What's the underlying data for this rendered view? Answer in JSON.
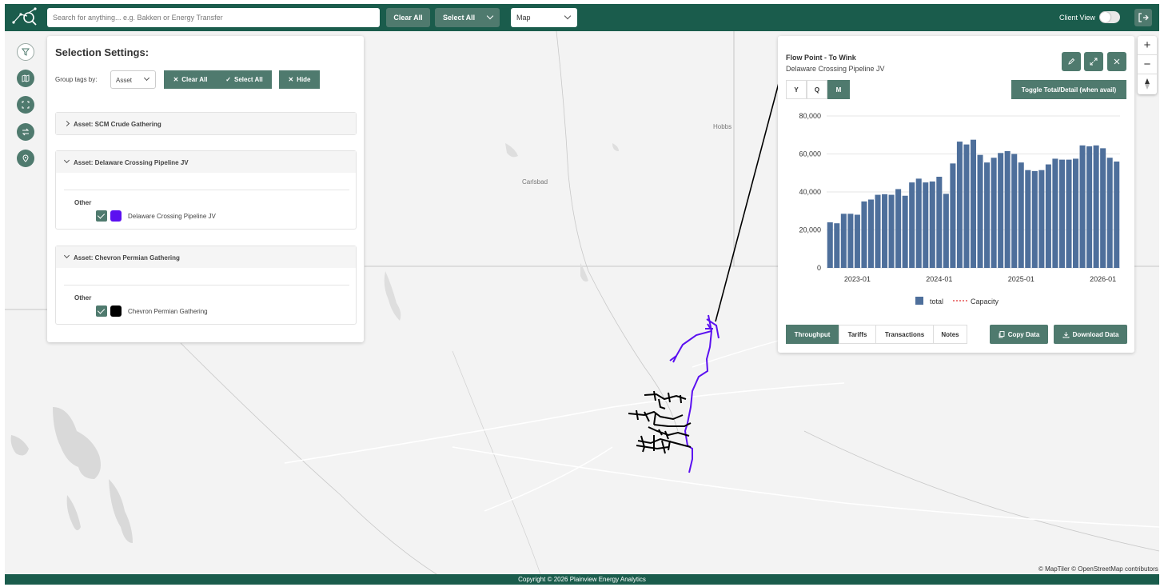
{
  "header": {
    "search_placeholder": "Search for anything... e.g. Bakken or Energy Transfer",
    "clear_all": "Clear All",
    "select_all": "Select All",
    "view_select": "Map",
    "client_view": "Client View"
  },
  "map": {
    "labels": {
      "hobbs": "Hobbs",
      "carlsbad": "Carlsbad"
    },
    "attribution": "© MapTiler © OpenStreetMap contributors",
    "logo": "maptiler",
    "pipeline_colors": {
      "delaware": "#5b10f0",
      "chevron": "#000000"
    }
  },
  "selection": {
    "title": "Selection Settings:",
    "group_label": "Group tags by:",
    "group_value": "Asset",
    "clear_all": "Clear All",
    "select_all": "Select All",
    "hide": "Hide",
    "sections": [
      {
        "title": "Asset: SCM Crude Gathering"
      },
      {
        "title": "Asset: Delaware Crossing Pipeline JV",
        "group": "Other",
        "item": "Delaware Crossing Pipeline JV",
        "color": "#5b10f0"
      },
      {
        "title": "Asset: Chevron Permian Gathering",
        "group": "Other",
        "item": "Chevron Permian Gathering",
        "color": "#000000"
      }
    ]
  },
  "detail": {
    "title": "Flow Point - To Wink",
    "subtitle": "Delaware Crossing Pipeline JV",
    "periods": [
      "Y",
      "Q",
      "M"
    ],
    "active_period": "M",
    "toggle_label": "Toggle Total/Detail (when avail)",
    "tabs": [
      "Throughput",
      "Tariffs",
      "Transactions",
      "Notes"
    ],
    "active_tab": "Throughput",
    "copy_data": "Copy Data",
    "download_data": "Download Data"
  },
  "chart_data": {
    "type": "bar",
    "series": [
      {
        "name": "total",
        "color": "#4e6f9b",
        "values": [
          24000,
          23500,
          28500,
          28500,
          28000,
          35000,
          36000,
          38500,
          38800,
          38500,
          41500,
          38000,
          45000,
          47000,
          45000,
          45500,
          48000,
          39000,
          55000,
          66500,
          65000,
          67500,
          59500,
          55500,
          58000,
          60500,
          61500,
          60000,
          55500,
          51500,
          51000,
          51500,
          54500,
          57500,
          57000,
          57000,
          57500,
          64500,
          64000,
          64500,
          63000,
          58000,
          56000
        ]
      },
      {
        "name": "Capacity",
        "color": "#e03030",
        "style": "dashed",
        "values": []
      }
    ],
    "x_start": "2022-09",
    "x_end": "2026-03",
    "xticks": [
      "2023-01",
      "2024-01",
      "2025-01",
      "2026-01"
    ],
    "yticks": [
      "80,000",
      "60,000",
      "40,000",
      "20,000",
      "0"
    ],
    "ylim": [
      0,
      80000
    ],
    "grid": true,
    "legend_position": "bottom"
  },
  "footer": {
    "text": "Copyright © 2026 Plainview Energy Analytics"
  },
  "colors": {
    "brand": "#1a5c4c",
    "button": "#4f7a6e"
  }
}
